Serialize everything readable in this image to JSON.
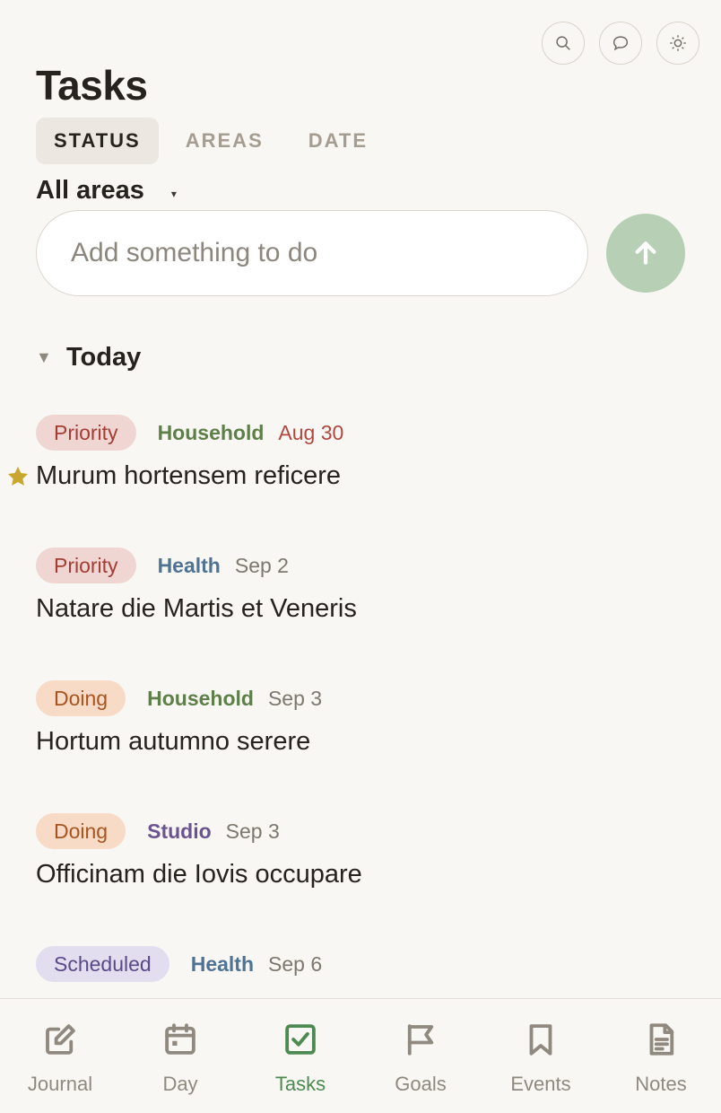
{
  "header": {
    "title": "Tasks",
    "icons": [
      "search-icon",
      "chat-icon",
      "theme-icon"
    ]
  },
  "tabs": [
    {
      "label": "STATUS",
      "active": true
    },
    {
      "label": "AREAS",
      "active": false
    },
    {
      "label": "DATE",
      "active": false
    }
  ],
  "filter": {
    "area_label": "All areas",
    "caret": "▾"
  },
  "add_task": {
    "placeholder": "Add something to do",
    "submit_icon": "arrow-up-icon"
  },
  "section": {
    "label": "Today",
    "toggle": "▼"
  },
  "tasks": [
    {
      "status": "Priority",
      "area": "Household",
      "date": "Aug 30",
      "text": "Murum hortensem reficere",
      "starred": true,
      "overdue": true
    },
    {
      "status": "Priority",
      "area": "Health",
      "date": "Sep 2",
      "text": "Natare die Martis et Veneris",
      "starred": false,
      "overdue": false
    },
    {
      "status": "Doing",
      "area": "Household",
      "date": "Sep 3",
      "text": "Hortum autumno serere",
      "starred": false,
      "overdue": false
    },
    {
      "status": "Doing",
      "area": "Studio",
      "date": "Sep 3",
      "text": "Officinam die Iovis occupare",
      "starred": false,
      "overdue": false
    },
    {
      "status": "Scheduled",
      "area": "Health",
      "date": "Sep 6",
      "text": "",
      "starred": false,
      "overdue": false
    }
  ],
  "colors": {
    "background": "#f9f7f3",
    "accent": "#4d8a51",
    "household": "#5e7f4a",
    "health": "#4f7394",
    "studio": "#6b5391",
    "star": "#c9a62f",
    "overdue": "#b2473e"
  },
  "nav": [
    {
      "label": "Journal",
      "icon": "pencil-square-icon",
      "active": false
    },
    {
      "label": "Day",
      "icon": "calendar-icon",
      "active": false
    },
    {
      "label": "Tasks",
      "icon": "checkbox-icon",
      "active": true
    },
    {
      "label": "Goals",
      "icon": "flag-icon",
      "active": false
    },
    {
      "label": "Events",
      "icon": "bookmark-icon",
      "active": false
    },
    {
      "label": "Notes",
      "icon": "document-icon",
      "active": false
    }
  ]
}
